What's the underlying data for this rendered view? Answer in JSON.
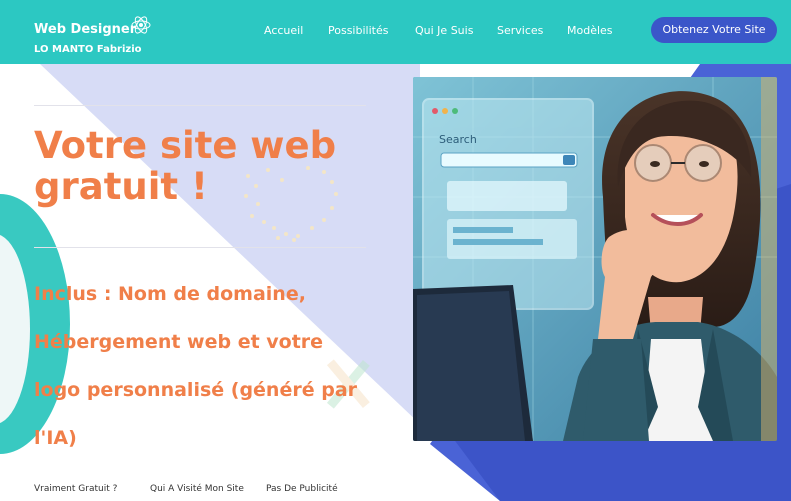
{
  "header": {
    "brand_title": "Web Designer",
    "brand_subtitle": "LO MANTO Fabrizio",
    "nav": [
      {
        "label": "Accueil"
      },
      {
        "label": "Possibilités"
      },
      {
        "label": "Qui Je Suis"
      },
      {
        "label": "Services"
      },
      {
        "label": "Modèles"
      }
    ],
    "cta_label": "Obtenez Votre Site"
  },
  "hero": {
    "headline_line1": "Votre site web",
    "headline_line2": "gratuit !",
    "subtext_lines": [
      "Inclus : Nom de domaine,",
      "Hébergement web et votre",
      "logo personnalisé (généré par",
      "l'IA)"
    ],
    "illustration_search_text": "Search"
  },
  "footer_links": [
    {
      "label": "Vraiment Gratuit ?"
    },
    {
      "label": "Qui A Visité Mon Site"
    },
    {
      "label": "Pas De Publicité"
    }
  ],
  "colors": {
    "header_bg": "#2cc8c2",
    "cta_bg": "#3b56c9",
    "headline": "#f07f49",
    "accent_blue": "#4a63d6",
    "lavender": "#d7dcf6"
  }
}
